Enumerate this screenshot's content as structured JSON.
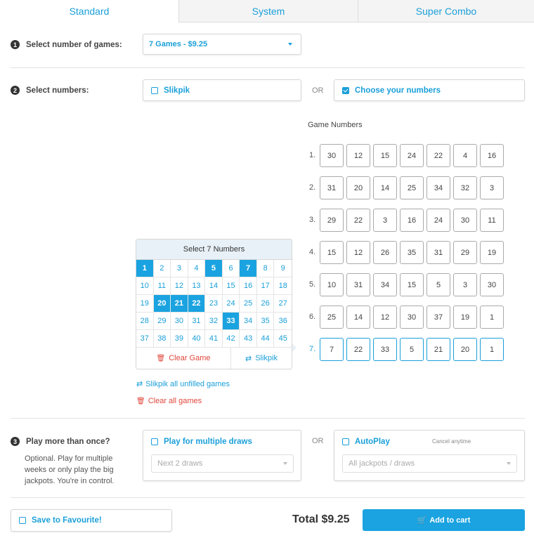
{
  "tabs": [
    {
      "label": "Standard"
    },
    {
      "label": "System"
    },
    {
      "label": "Super Combo"
    }
  ],
  "step1": {
    "num": "1",
    "label": "Select number of games:",
    "select_value": "7 Games - $9.25"
  },
  "step2": {
    "num": "2",
    "label": "Select numbers:",
    "slikpik_label": "Slikpik",
    "or": "OR",
    "choose_label": "Choose your numbers"
  },
  "game_numbers": {
    "title": "Game Numbers",
    "games": [
      {
        "label": "1.",
        "numbers": [
          "30",
          "12",
          "15",
          "24",
          "22",
          "4",
          "16"
        ]
      },
      {
        "label": "2.",
        "numbers": [
          "31",
          "20",
          "14",
          "25",
          "34",
          "32",
          "3"
        ]
      },
      {
        "label": "3.",
        "numbers": [
          "29",
          "22",
          "3",
          "16",
          "24",
          "30",
          "11"
        ]
      },
      {
        "label": "4.",
        "numbers": [
          "15",
          "12",
          "26",
          "35",
          "31",
          "29",
          "19"
        ]
      },
      {
        "label": "5.",
        "numbers": [
          "10",
          "31",
          "34",
          "15",
          "5",
          "3",
          "30"
        ]
      },
      {
        "label": "6.",
        "numbers": [
          "25",
          "14",
          "12",
          "30",
          "37",
          "19",
          "1"
        ]
      },
      {
        "label": "7.",
        "numbers": [
          "7",
          "22",
          "33",
          "5",
          "21",
          "20",
          "1"
        ]
      }
    ]
  },
  "picker": {
    "title": "Select 7 Numbers",
    "numbers": [
      "1",
      "2",
      "3",
      "4",
      "5",
      "6",
      "7",
      "8",
      "9",
      "10",
      "11",
      "12",
      "13",
      "14",
      "15",
      "16",
      "17",
      "18",
      "19",
      "20",
      "21",
      "22",
      "23",
      "24",
      "25",
      "26",
      "27",
      "28",
      "29",
      "30",
      "31",
      "32",
      "33",
      "34",
      "35",
      "36",
      "37",
      "38",
      "39",
      "40",
      "41",
      "42",
      "43",
      "44",
      "45"
    ],
    "selected": [
      "1",
      "5",
      "7",
      "20",
      "21",
      "22",
      "33"
    ],
    "clear_game": "Clear Game",
    "slikpik": "Slikpik"
  },
  "links": {
    "slikpik_all": "Slikpik all unfilled games",
    "clear_all": "Clear all games"
  },
  "step3": {
    "num": "3",
    "label": "Play more than once?",
    "description": "Optional. Play for multiple weeks or only play the big jackpots. You're in control.",
    "multi_label": "Play for multiple draws",
    "multi_select": "Next 2 draws",
    "or": "OR",
    "autoplay_label": "AutoPlay",
    "cancel_note": "Cancel anytime",
    "autoplay_select": "All jackpots / draws"
  },
  "footer": {
    "favourite": "Save to Favourite!",
    "total": "Total $9.25",
    "add_to_cart": "Add to cart"
  },
  "colors": {
    "accent": "#1a9fd9",
    "danger": "#e0463a",
    "button": "#1aa3e0"
  }
}
